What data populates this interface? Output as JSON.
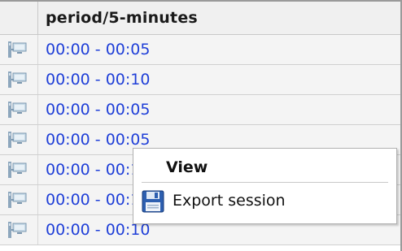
{
  "column": {
    "header": "period/5-minutes"
  },
  "rows": [
    {
      "period": "00:00 - 00:05"
    },
    {
      "period": "00:00 - 00:10"
    },
    {
      "period": "00:00 - 00:05"
    },
    {
      "period": "00:00 - 00:05"
    },
    {
      "period": "00:00 - 00:10"
    },
    {
      "period": "00:00 - 00:10"
    },
    {
      "period": "00:00 - 00:10"
    }
  ],
  "context_menu": {
    "items": [
      {
        "label": "View"
      },
      {
        "label": "Export session",
        "icon": "floppy-disk-icon"
      }
    ]
  },
  "colors": {
    "link_text": "#1f3fd8",
    "row_background": "#f4f4f4",
    "header_background": "#f0f0f0"
  },
  "icons": {
    "row": "computer-session-icon"
  }
}
